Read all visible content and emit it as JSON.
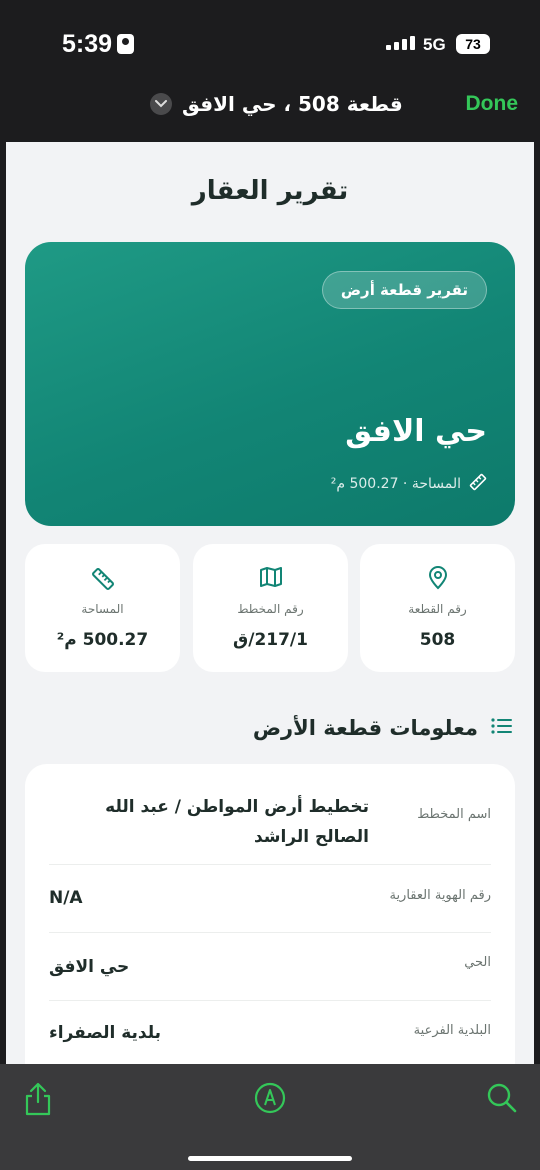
{
  "status": {
    "time": "5:39",
    "network": "5G",
    "battery": "73"
  },
  "nav": {
    "title": "قطعة 508 ، حي الافق",
    "done_label": "Done"
  },
  "page": {
    "title": "تقرير العقار"
  },
  "hero": {
    "badge": "تقرير قطعة أرض",
    "name": "حي الافق",
    "area_text": "المساحة · 500.27 م²"
  },
  "cards": [
    {
      "label": "رقم القطعة",
      "value": "508",
      "icon": "location-pin-icon"
    },
    {
      "label": "رقم المخطط",
      "value": "217/1/ق",
      "icon": "map-icon"
    },
    {
      "label": "المساحة",
      "value": "500.27 م²",
      "icon": "ruler-icon"
    }
  ],
  "section": {
    "title": "معلومات قطعة الأرض",
    "icon": "list-icon"
  },
  "info_rows": [
    {
      "label": "اسم المخطط",
      "value": "تخطيط أرض المواطن / عبد الله الصالح الراشد"
    },
    {
      "label": "رقم الهوية العقارية",
      "value": "N/A"
    },
    {
      "label": "الحي",
      "value": "حي الافق"
    },
    {
      "label": "البلدية الفرعية",
      "value": "بلدية الصفراء"
    }
  ],
  "colors": {
    "accent": "#34c759",
    "teal": "#128575",
    "text": "#1f2d2a"
  }
}
